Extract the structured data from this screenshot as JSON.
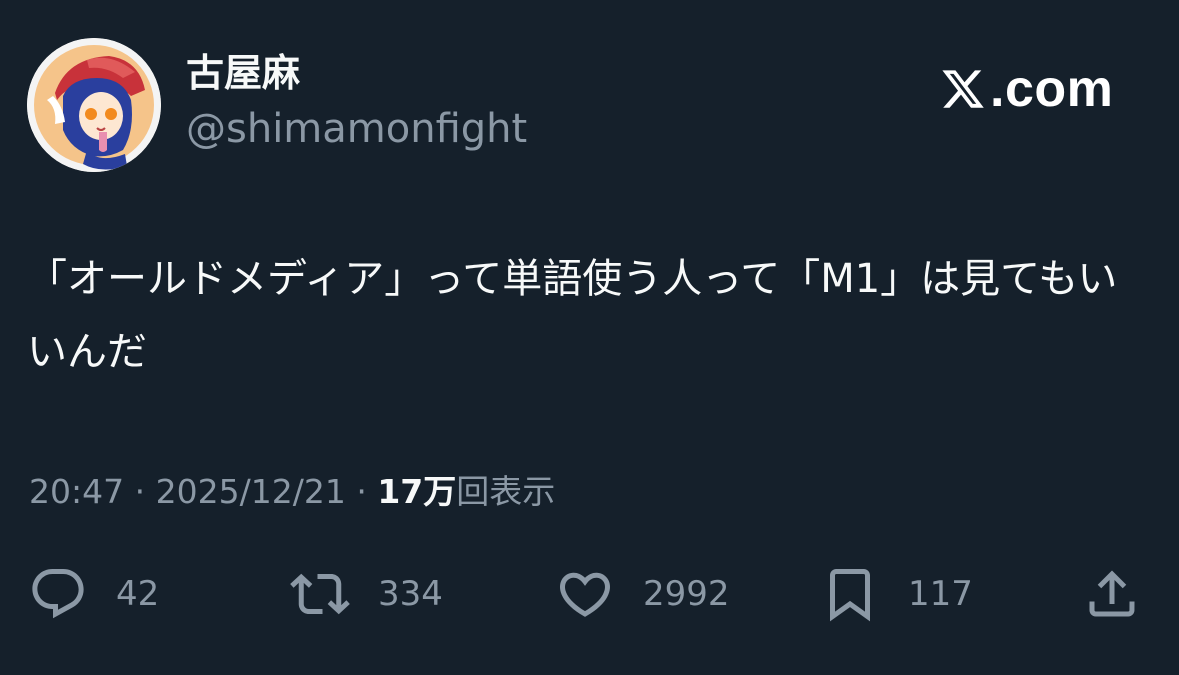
{
  "author": {
    "display_name": "古屋麻",
    "handle": "@shimamonfight"
  },
  "brand": {
    "text": ".com",
    "logo": "x-logo"
  },
  "tweet": {
    "text": "「オールドメディア」って単語使う人って「M1」は見てもいいんだ"
  },
  "meta": {
    "time": "20:47",
    "separator": "·",
    "date": "2025/12/21",
    "views_count": "17万",
    "views_label": "回表示"
  },
  "actions": {
    "reply": {
      "icon": "reply-icon",
      "count": "42"
    },
    "retweet": {
      "icon": "retweet-icon",
      "count": "334"
    },
    "like": {
      "icon": "like-icon",
      "count": "2992"
    },
    "bookmark": {
      "icon": "bookmark-icon",
      "count": "117"
    },
    "share": {
      "icon": "share-icon"
    }
  },
  "colors": {
    "background": "#15202b",
    "text": "#f7f9f9",
    "secondary_text": "#8b98a5"
  }
}
